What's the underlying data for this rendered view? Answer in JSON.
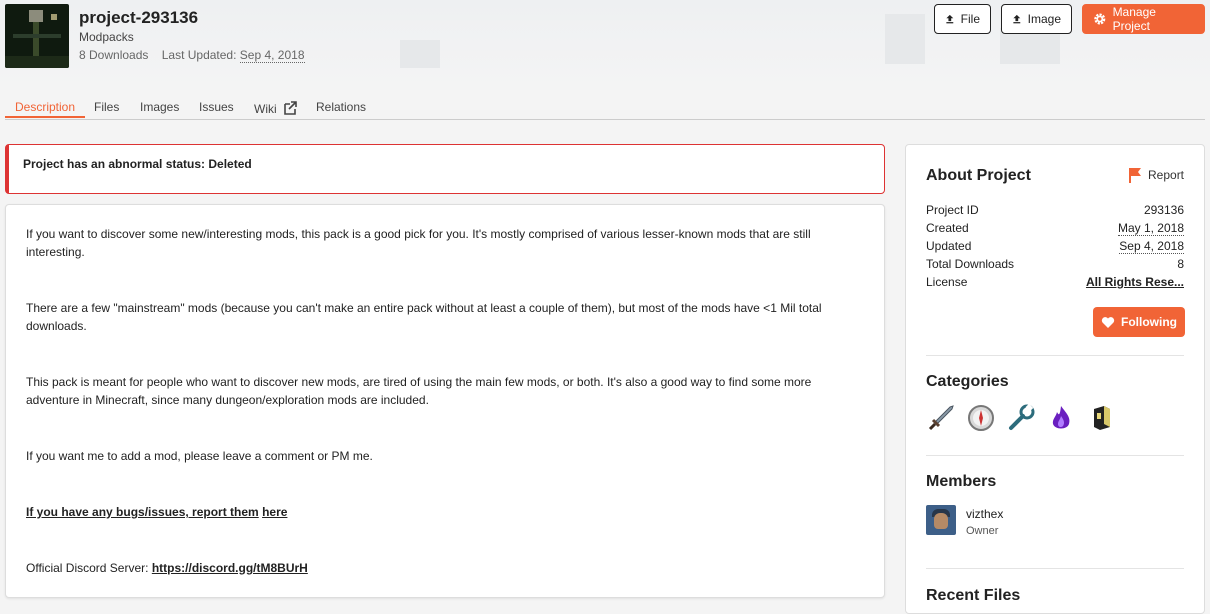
{
  "project": {
    "title": "project-293136",
    "category": "Modpacks",
    "downloads": "8 Downloads",
    "last_updated_label": "Last Updated:",
    "last_updated": "Sep 4, 2018"
  },
  "header_buttons": {
    "file": "File",
    "image": "Image",
    "manage": "Manage Project"
  },
  "tabs": [
    {
      "label": "Description",
      "active": true
    },
    {
      "label": "Files"
    },
    {
      "label": "Images"
    },
    {
      "label": "Issues"
    },
    {
      "label": "Wiki"
    },
    {
      "label": "Relations"
    }
  ],
  "alert": {
    "text": "Project has an abnormal status: Deleted"
  },
  "description": {
    "p1": "If you want to discover some new/interesting mods, this pack is a good pick for you. It's mostly comprised of various lesser-known mods that are still interesting.",
    "p2": "There are a few \"mainstream\" mods (because you can't make an entire pack without at least a couple of them), but most of the mods have <1 Mil total downloads.",
    "p3": "This pack is meant for people who want to discover new mods, are tired of using the main few mods, or both. It's also a good way to find some more adventure in Minecraft, since many dungeon/exploration mods are included.",
    "p4": "If you want me to add a mod, please leave a comment or PM me.",
    "p5_link": "If you have any bugs/issues, report them",
    "p5_here": "here",
    "p6_prefix": "Official Discord Server:",
    "p6_link": "https://discord.gg/tM8BUrH"
  },
  "about": {
    "heading": "About Project",
    "report": "Report",
    "rows": [
      {
        "key": "Project ID",
        "value": "293136"
      },
      {
        "key": "Created",
        "value": "May 1, 2018"
      },
      {
        "key": "Updated",
        "value": "Sep 4, 2018"
      },
      {
        "key": "Total Downloads",
        "value": "8"
      },
      {
        "key": "License",
        "value": "All Rights Rese..."
      }
    ],
    "follow": "Following"
  },
  "categories": {
    "heading": "Categories",
    "icons": [
      "sword-icon",
      "compass-icon",
      "wrench-icon",
      "purple-flame-icon",
      "block-icon"
    ]
  },
  "members": {
    "heading": "Members",
    "items": [
      {
        "name": "vizthex",
        "role": "Owner"
      }
    ]
  },
  "recent_files": {
    "heading": "Recent Files"
  },
  "colors": {
    "accent": "#f16436",
    "alert_border": "#dd3333"
  }
}
